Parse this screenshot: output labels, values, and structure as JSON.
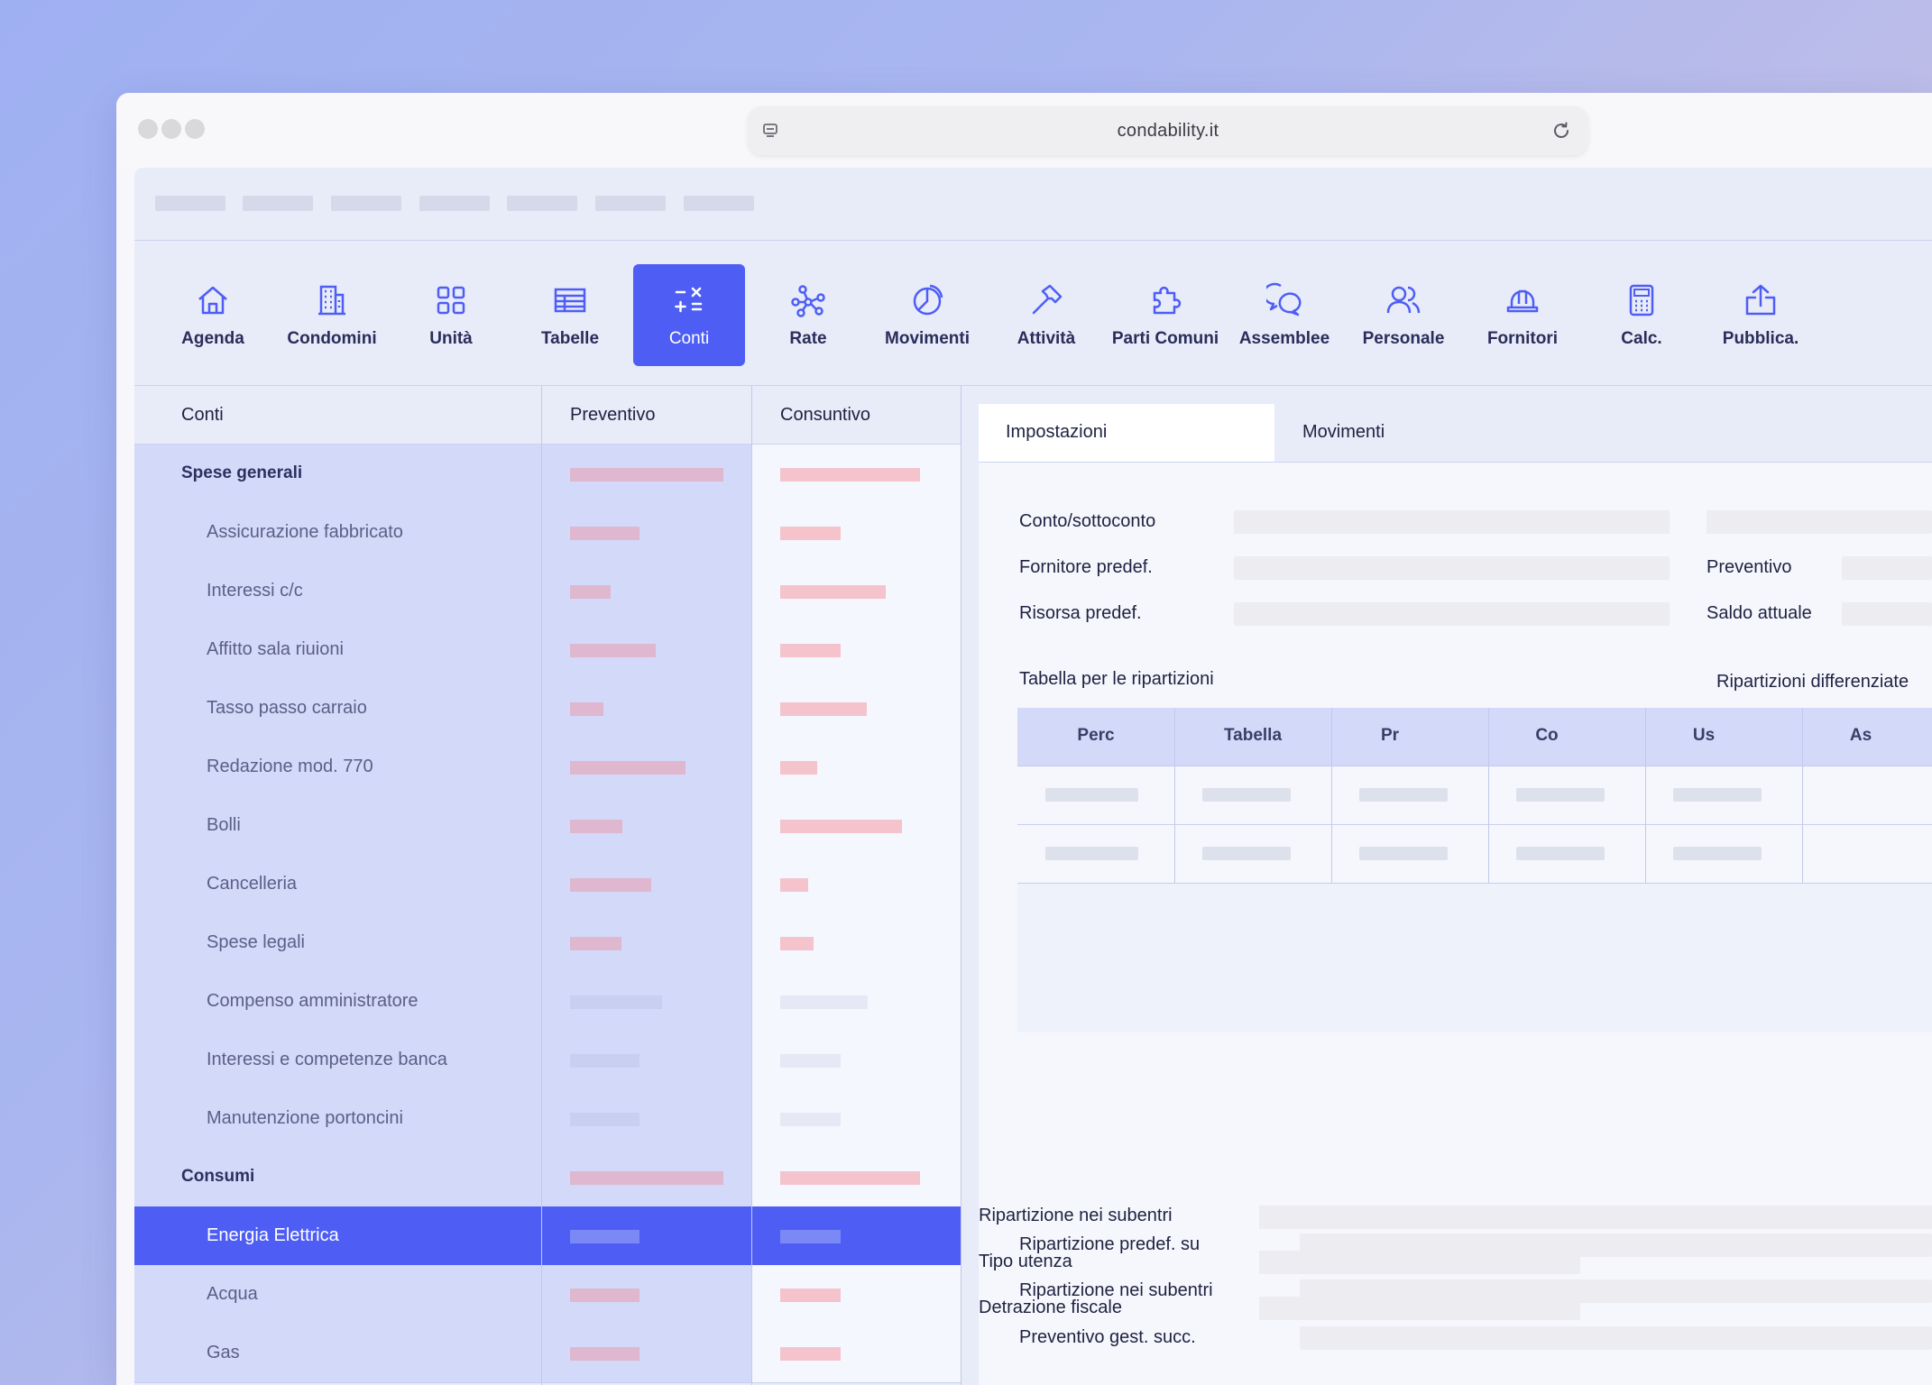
{
  "browser": {
    "url": "condability.it"
  },
  "toolbar": {
    "items": [
      {
        "label": "Agenda",
        "icon": "home-icon"
      },
      {
        "label": "Condomini",
        "icon": "building-icon"
      },
      {
        "label": "Unità",
        "icon": "grid-icon"
      },
      {
        "label": "Tabelle",
        "icon": "table-icon"
      },
      {
        "label": "Conti",
        "icon": "calculator-ops-icon",
        "active": true
      },
      {
        "label": "Rate",
        "icon": "network-icon"
      },
      {
        "label": "Movimenti",
        "icon": "pie-chart-icon"
      },
      {
        "label": "Attività",
        "icon": "hammer-icon"
      },
      {
        "label": "Parti Comuni",
        "icon": "puzzle-icon"
      },
      {
        "label": "Assemblee",
        "icon": "chat-bubbles-icon"
      },
      {
        "label": "Personale",
        "icon": "users-icon"
      },
      {
        "label": "Fornitori",
        "icon": "hard-hat-icon"
      },
      {
        "label": "Calc.",
        "icon": "calculator-icon"
      },
      {
        "label": "Pubblica.",
        "icon": "upload-icon"
      }
    ]
  },
  "accounts_table": {
    "headers": [
      "Conti",
      "Preventivo",
      "Consuntivo"
    ],
    "rows": [
      {
        "name": "Spese generali",
        "type": "group"
      },
      {
        "name": "Assicurazione fabbricato",
        "type": "sub"
      },
      {
        "name": "Interessi c/c",
        "type": "sub"
      },
      {
        "name": "Affitto sala riuioni",
        "type": "sub"
      },
      {
        "name": "Tasso passo carraio",
        "type": "sub"
      },
      {
        "name": "Redazione mod. 770",
        "type": "sub"
      },
      {
        "name": "Bolli",
        "type": "sub"
      },
      {
        "name": "Cancelleria",
        "type": "sub"
      },
      {
        "name": "Spese legali",
        "type": "sub"
      },
      {
        "name": "Compenso amministratore",
        "type": "sub"
      },
      {
        "name": "Interessi e competenze banca",
        "type": "sub"
      },
      {
        "name": "Manutenzione portoncini",
        "type": "sub"
      },
      {
        "name": "Consumi",
        "type": "group"
      },
      {
        "name": "Energia Elettrica",
        "type": "sub",
        "selected": true
      },
      {
        "name": "Acqua",
        "type": "sub"
      },
      {
        "name": "Gas",
        "type": "sub"
      }
    ]
  },
  "detail": {
    "tabs": [
      "Impostazioni",
      "Movimenti"
    ],
    "fields_top": {
      "conto": "Conto/sottoconto",
      "fornitore": "Fornitore predef.",
      "risorsa": "Risorsa predef.",
      "preventivo": "Preventivo",
      "saldo": "Saldo attuale"
    },
    "tabella_label": "Tabella per le ripartizioni",
    "ripartizioni_diff": "Ripartizioni differenziate",
    "grid_headers": [
      "Perc",
      "Tabella",
      "Pr",
      "Co",
      "Us",
      "As"
    ],
    "fields_bottom": [
      "Ripartizione predef. su",
      "Ripartizione nei subentri",
      "Preventivo gest. succ.",
      "Ripartizione nei subentri",
      "Tipo utenza",
      "Detrazione fiscale"
    ]
  },
  "colors": {
    "accent": "#4e5ef5",
    "bar_preventivo": "#dfb7ce",
    "bar_consuntivo": "#f5c3cc",
    "bar_muted": "#c9cff0"
  }
}
